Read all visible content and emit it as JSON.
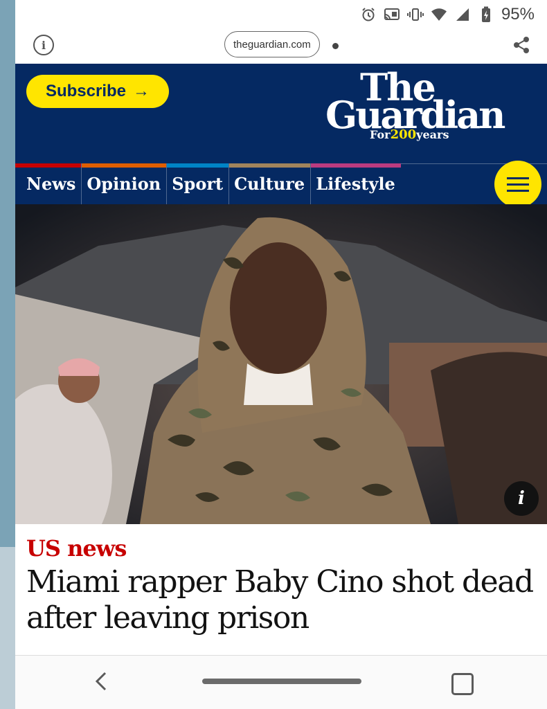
{
  "status_bar": {
    "battery": "95%",
    "icons": [
      "alarm-icon",
      "cast-icon",
      "vibrate-icon",
      "wifi-icon",
      "signal-icon",
      "battery-charging-icon"
    ]
  },
  "browser": {
    "url": "theguardian.com",
    "info_icon": "info-icon",
    "share_icon": "share-icon"
  },
  "masthead": {
    "subscribe_label": "Subscribe",
    "subscribe_arrow": "→",
    "logo_line1": "The",
    "logo_line2": "Guardian",
    "tagline_prefix": "For",
    "tagline_number": "200",
    "tagline_suffix": "years",
    "colors": {
      "brand_blue": "#052962",
      "accent_yellow": "#ffe500"
    }
  },
  "nav": {
    "items": [
      {
        "label": "News",
        "color": "#c70000"
      },
      {
        "label": "Opinion",
        "color": "#e05e00"
      },
      {
        "label": "Sport",
        "color": "#0084c6"
      },
      {
        "label": "Culture",
        "color": "#a1845c"
      },
      {
        "label": "Lifestyle",
        "color": "#bb3b80"
      }
    ],
    "menu_icon": "hamburger-menu-icon"
  },
  "hero": {
    "info_label": "i"
  },
  "article": {
    "section": "US news",
    "headline": "Miami rapper Baby Cino shot dead after leaving prison",
    "section_color": "#c70000"
  },
  "system_nav": {
    "icons": [
      "back-icon",
      "home-pill",
      "recents-icon"
    ]
  }
}
